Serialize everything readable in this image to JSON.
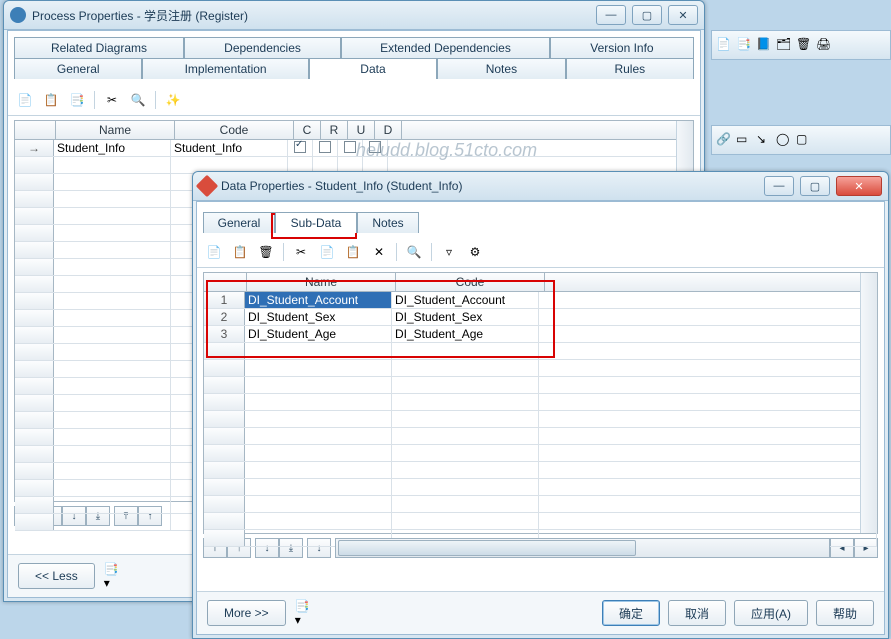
{
  "watermark": "heludd.blog.51cto.com",
  "win1": {
    "title": "Process Properties - 学员注册 (Register)",
    "tabs_row1": [
      "Related Diagrams",
      "Dependencies",
      "Extended Dependencies",
      "Version Info"
    ],
    "tabs_row2": [
      "General",
      "Implementation",
      "Data",
      "Notes",
      "Rules"
    ],
    "active_tab": "Data",
    "grid": {
      "headers": [
        "",
        "Name",
        "Code",
        "C",
        "R",
        "U",
        "D"
      ],
      "row": {
        "name": "Student_Info",
        "code": "Student_Info",
        "c": true,
        "r": false,
        "u": false,
        "d": false
      }
    },
    "less_btn": "<< Less"
  },
  "win2": {
    "title": "Data Properties - Student_Info (Student_Info)",
    "tabs": [
      "General",
      "Sub-Data",
      "Notes"
    ],
    "active_tab": "Sub-Data",
    "grid": {
      "headers": [
        "",
        "Name",
        "Code"
      ],
      "rows": [
        {
          "n": "1",
          "name": "DI_Student_Account",
          "code": "DI_Student_Account"
        },
        {
          "n": "2",
          "name": "DI_Student_Sex",
          "code": "DI_Student_Sex"
        },
        {
          "n": "3",
          "name": "DI_Student_Age",
          "code": "DI_Student_Age"
        }
      ]
    },
    "buttons": {
      "more": "More >>",
      "ok": "确定",
      "cancel": "取消",
      "apply": "应用(A)",
      "help": "帮助"
    }
  }
}
